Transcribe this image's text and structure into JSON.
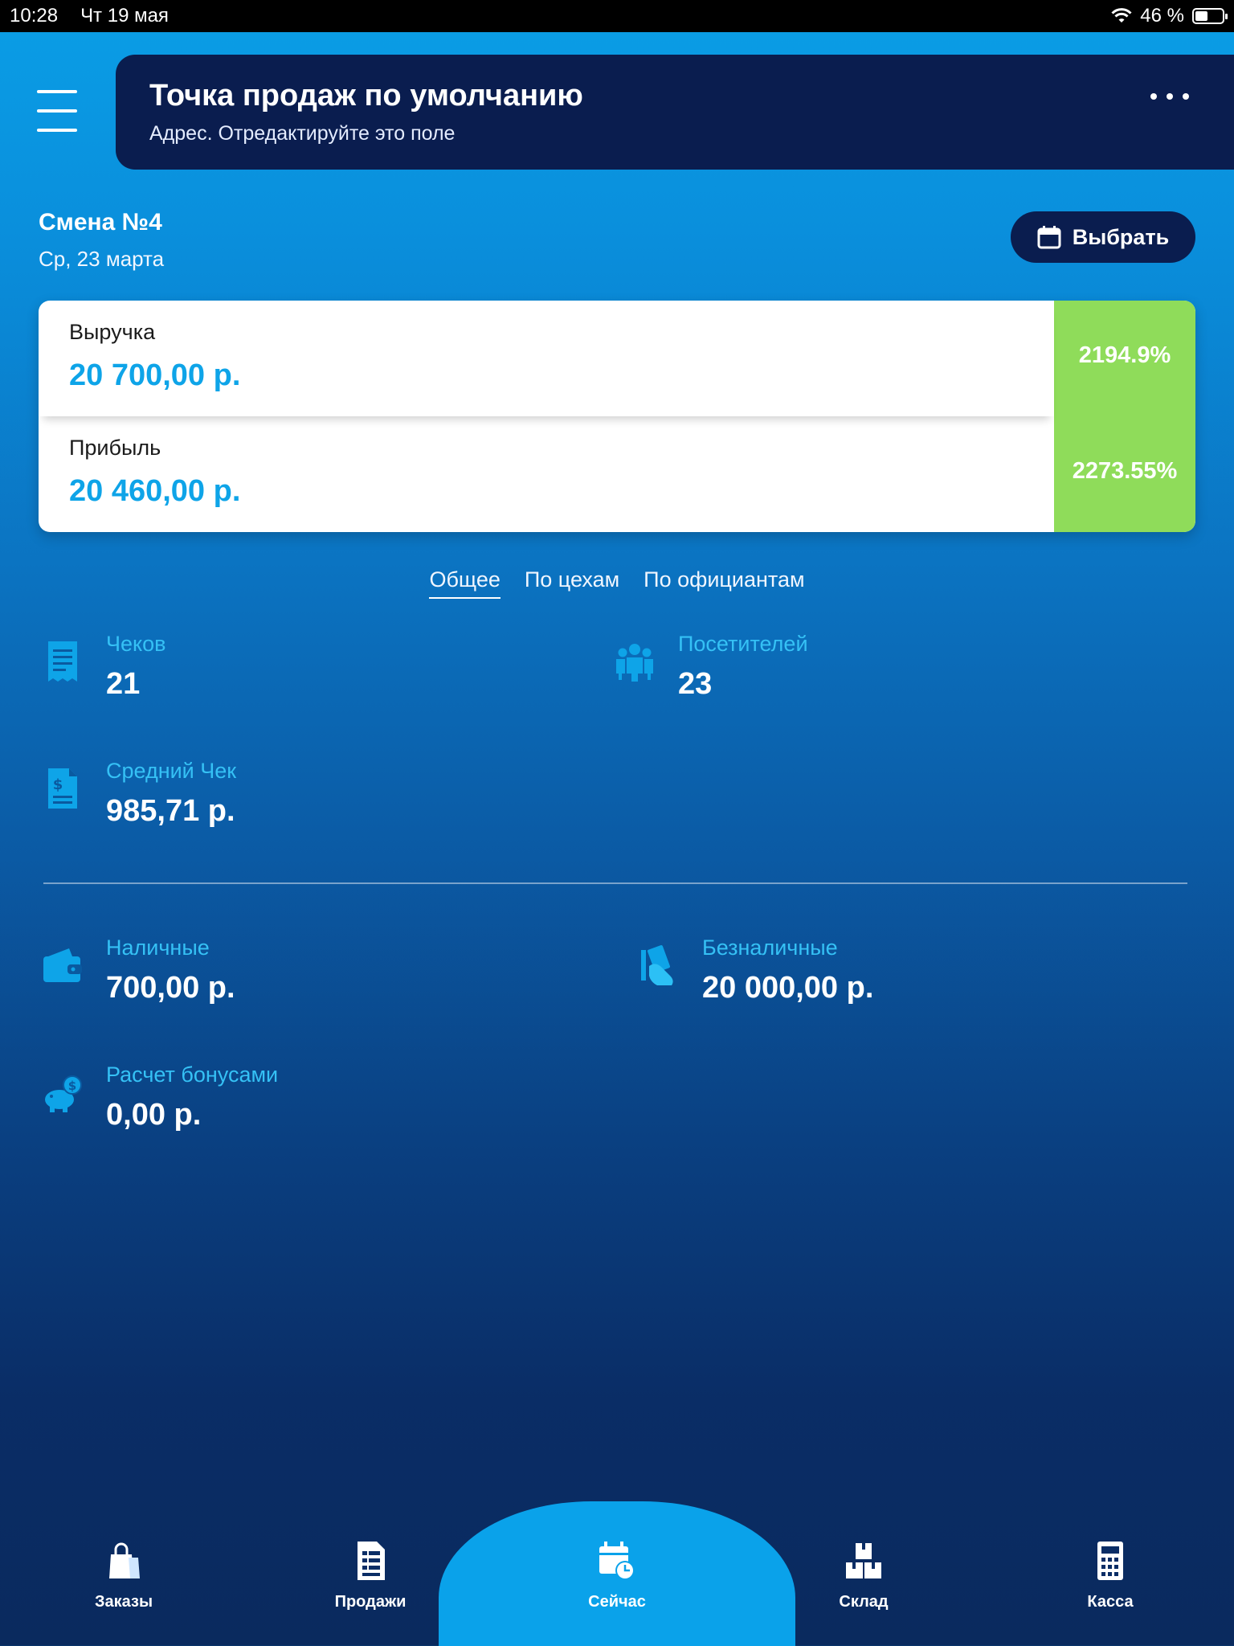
{
  "status_bar": {
    "time": "10:28",
    "date": "Чт 19 мая",
    "battery_text": "46 %",
    "battery_level": 0.46,
    "wifi_icon": "wifi-icon"
  },
  "header": {
    "title": "Точка продаж по умолчанию",
    "subtitle": "Адрес. Отредактируйте это поле",
    "menu_icon": "hamburger-icon",
    "more_icon": "more-dots-icon"
  },
  "shift": {
    "title": "Смена №4",
    "date": "Ср, 23 марта",
    "select_label": "Выбрать",
    "select_icon": "calendar-icon"
  },
  "stats": {
    "revenue_label": "Выручка",
    "revenue_value": "20 700,00 р.",
    "revenue_pct": "2194.9%",
    "profit_label": "Прибыль",
    "profit_value": "20 460,00 р.",
    "profit_pct": "2273.55%"
  },
  "tabs": [
    {
      "label": "Общее",
      "active": true
    },
    {
      "label": "По цехам",
      "active": false
    },
    {
      "label": "По официантам",
      "active": false
    }
  ],
  "metrics": {
    "checks": {
      "label": "Чеков",
      "value": "21",
      "icon": "receipt-icon"
    },
    "visitors": {
      "label": "Посетителей",
      "value": "23",
      "icon": "people-icon"
    },
    "avg_check": {
      "label": "Средний Чек",
      "value": "985,71 р.",
      "icon": "invoice-dollar-icon"
    },
    "cash": {
      "label": "Наличные",
      "value": "700,00 р.",
      "icon": "wallet-icon"
    },
    "cashless": {
      "label": "Безналичные",
      "value": "20 000,00 р.",
      "icon": "card-hand-icon"
    },
    "bonus": {
      "label": "Расчет бонусами",
      "value": "0,00 р.",
      "icon": "piggy-bank-icon"
    }
  },
  "nav": [
    {
      "label": "Заказы",
      "icon": "shopping-bag-icon",
      "active": false
    },
    {
      "label": "Продажи",
      "icon": "sales-document-icon",
      "active": false
    },
    {
      "label": "Сейчас",
      "icon": "calendar-clock-icon",
      "active": true
    },
    {
      "label": "Склад",
      "icon": "boxes-icon",
      "active": false
    },
    {
      "label": "Касса",
      "icon": "calculator-icon",
      "active": false
    }
  ],
  "colors": {
    "accent": "#0ea4e8",
    "header_bg": "#0a1d4f",
    "positive": "#8fdc5a",
    "label_blue": "#35c1f5"
  }
}
